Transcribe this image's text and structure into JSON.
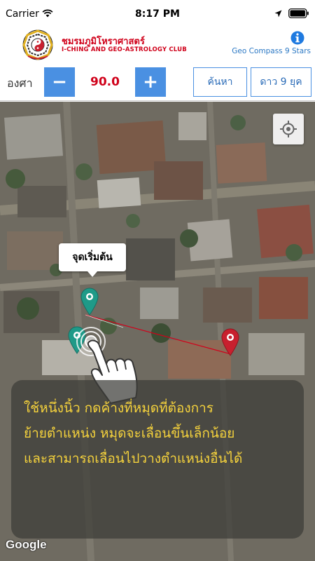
{
  "status_bar": {
    "carrier": "Carrier",
    "time": "8:17 PM"
  },
  "header": {
    "title_th": "ชมรมภูมิโหราศาสตร์",
    "title_en": "I-CHING AND GEO-ASTROLOGY CLUB",
    "app_name": "Geo Compass 9 Stars"
  },
  "controls": {
    "degree_label": "องศา",
    "degree_value": "90.0",
    "minus_label": "−",
    "plus_label": "+",
    "search_label": "ค้นหา",
    "nine_stars_label": "ดาว 9 ยุค"
  },
  "map": {
    "start_label": "จุดเริ่มต้น",
    "tutorial_lines": [
      "ใช้หนึ่งนิ้ว กดค้างที่หมุดที่ต้องการ",
      "ย้ายตำแหน่ง หมุดจะเลื่อนขึ้นเล็กน้อย",
      "และสามารถเลื่อนไปวางตำแหน่งอื่นได้"
    ],
    "attribution": "Google"
  },
  "colors": {
    "accent_blue": "#4a90e2",
    "title_red": "#d0021b",
    "pin_green": "#1f9a88",
    "pin_red": "#c8202e",
    "tutorial_text": "#f5d23c"
  },
  "icons": [
    "wifi-icon",
    "location-arrow-icon",
    "battery-icon",
    "info-icon",
    "locate-icon",
    "map-pin-icon",
    "hand-pointer-icon"
  ]
}
